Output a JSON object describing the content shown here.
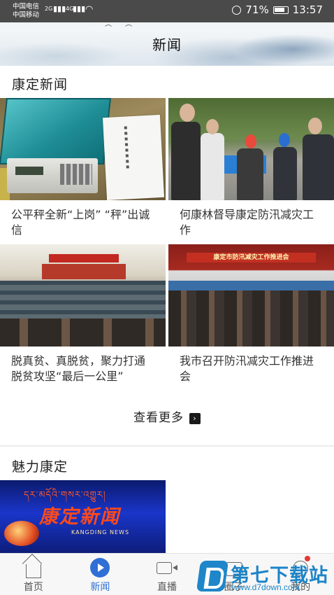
{
  "status_bar": {
    "carrier_1": "中国电信",
    "carrier_2": "中国移动",
    "network_1": "2G",
    "network_2": "4G",
    "battery_percent": "71%",
    "time": "13:57"
  },
  "header": {
    "title": "新闻"
  },
  "sections": {
    "kangding_news": {
      "title": "康定新闻"
    },
    "charm_kangding": {
      "title": "魅力康定"
    }
  },
  "news": [
    {
      "caption": "公平秤全新“上岗” “秤”出诚信"
    },
    {
      "caption": "何康林督导康定防汛减灾工作"
    },
    {
      "caption": "脱真贫、真脱贫，聚力打通脱贫攻坚“最后一公里”"
    },
    {
      "caption": "我市召开防汛减灾工作推进会"
    }
  ],
  "image_text": {
    "conference_banner": "康定市防汛减灾工作推进会",
    "video_tibetan": "དར་མདོའི་གསར་འགྱུར།",
    "video_logo": "康定新闻",
    "video_sub": "KANGDING NEWS"
  },
  "view_more": {
    "label": "查看更多"
  },
  "bottom_nav": [
    {
      "label": "首页",
      "icon": "home-icon",
      "active": false
    },
    {
      "label": "新闻",
      "icon": "news-play-icon",
      "active": true
    },
    {
      "label": "直播",
      "icon": "live-camera-icon",
      "active": false
    },
    {
      "label": "圈子",
      "icon": "circle-icon",
      "active": false
    },
    {
      "label": "我的",
      "icon": "profile-icon",
      "active": false
    }
  ],
  "watermark": {
    "text": "第七下载站",
    "url": "www.d7down.com"
  },
  "colors": {
    "accent": "#2f6fd6",
    "status_bar": "#4a4a4a",
    "badge": "#e53935"
  }
}
